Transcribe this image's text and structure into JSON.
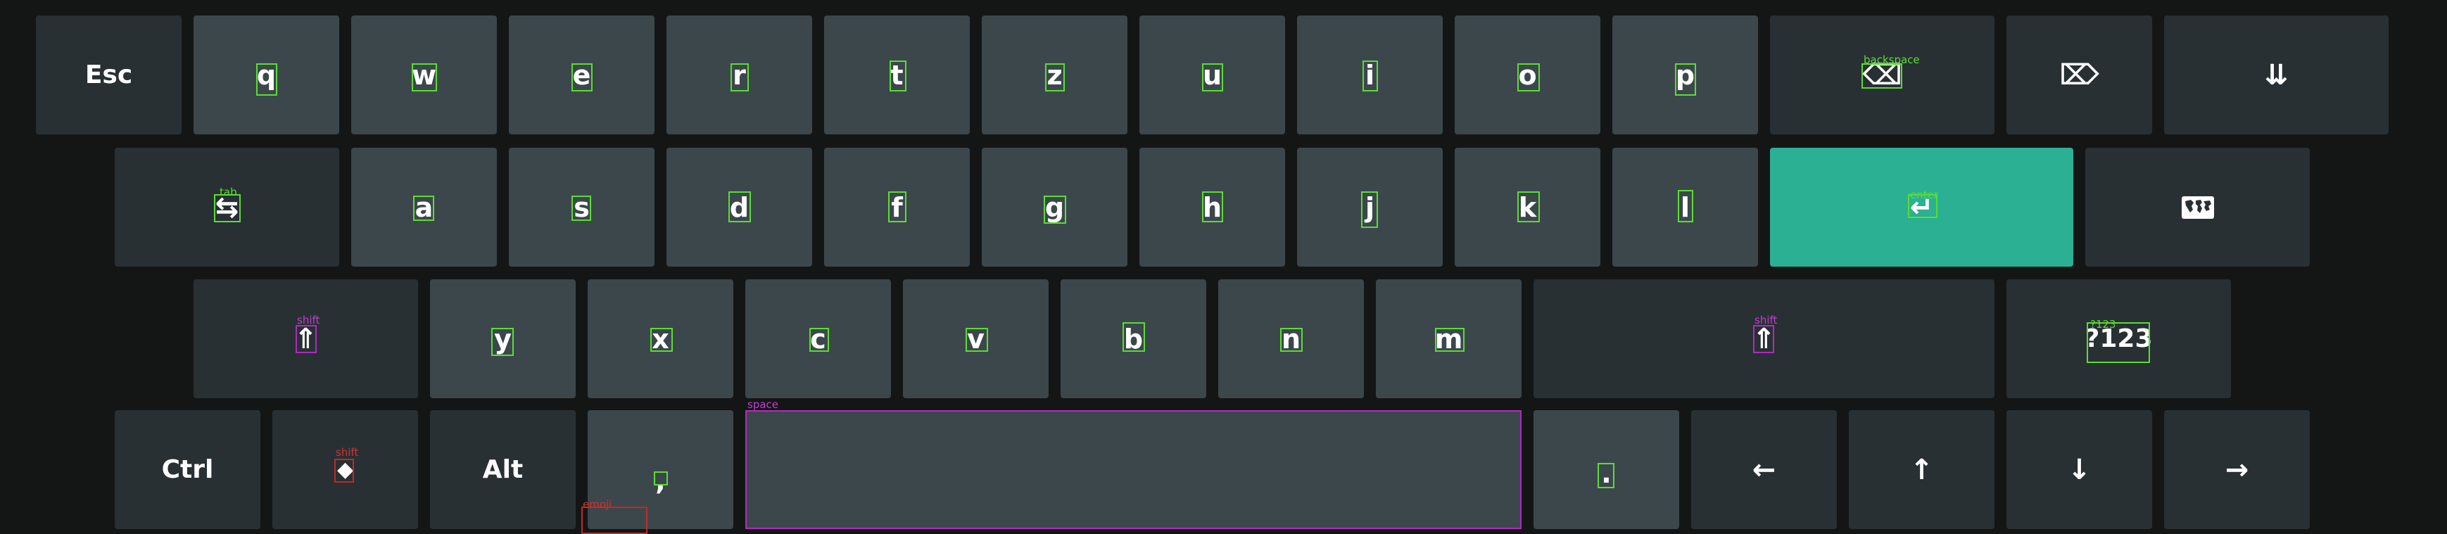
{
  "keyboard": {
    "row1": {
      "esc": "Esc",
      "q": "q",
      "w": "w",
      "e": "e",
      "r": "r",
      "t": "t",
      "z": "z",
      "u": "u",
      "i": "i",
      "o": "o",
      "p": "p",
      "backspace_symbol": "⌫",
      "delete_symbol": "⌦",
      "hide_symbol": "⇊"
    },
    "row2": {
      "tab_symbol": "⇆",
      "a": "a",
      "s": "s",
      "d": "d",
      "f": "f",
      "g": "g",
      "h": "h",
      "j": "j",
      "k": "k",
      "l": "l",
      "enter_symbol": "↵",
      "lang_icon": "world-map-icon"
    },
    "row3": {
      "shift_symbol": "⇑",
      "y": "y",
      "x": "x",
      "c": "c",
      "v": "v",
      "b": "b",
      "n": "n",
      "m": "m",
      "shift_right_symbol": "⇑",
      "numeric": "?123"
    },
    "row4": {
      "ctrl": "Ctrl",
      "super_symbol": "◆",
      "alt": "Alt",
      "comma": ",",
      "period": ".",
      "left": "←",
      "up": "↑",
      "down": "↓",
      "right": "→"
    }
  },
  "debug_overlay": {
    "labels": {
      "backspace": "backspace",
      "tab": "tab",
      "shift_left": "shift",
      "shift_right": "shift",
      "numeric": "?123",
      "space": "space",
      "super_shift": "shift",
      "emoji": "emoji",
      "enter": "enter"
    }
  },
  "colors": {
    "background": "#141616",
    "char_key": "#3c474c",
    "func_key": "#283034",
    "enter_key": "#2bb094",
    "overlay_green": "#5bdd33",
    "overlay_magenta": "#b22ac0",
    "overlay_red": "#c42828"
  }
}
